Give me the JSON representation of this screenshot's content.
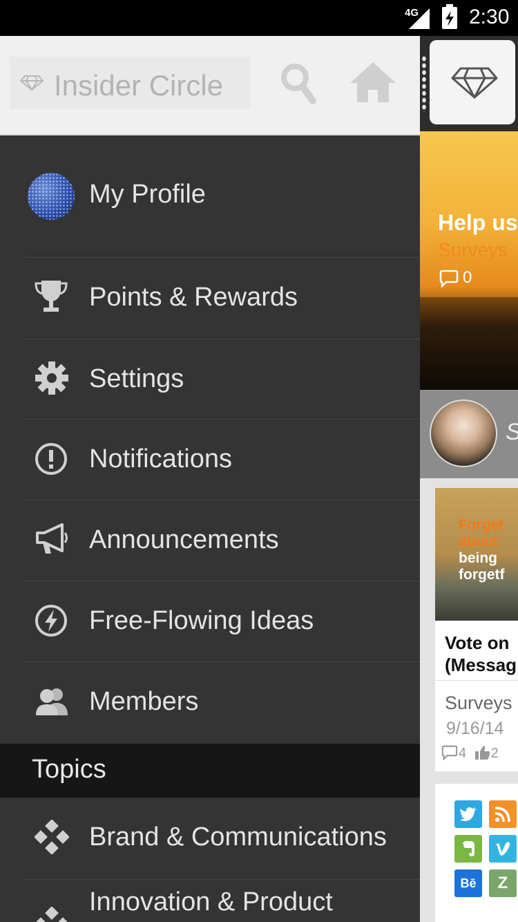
{
  "status_bar": {
    "network": "4G",
    "time": "2:30"
  },
  "drawer": {
    "search_placeholder": "Insider Circle",
    "items": [
      {
        "label": "My Profile",
        "icon": "avatar"
      },
      {
        "label": "Points & Rewards",
        "icon": "trophy-icon"
      },
      {
        "label": "Settings",
        "icon": "gear-icon"
      },
      {
        "label": "Notifications",
        "icon": "alert-icon"
      },
      {
        "label": "Announcements",
        "icon": "megaphone-icon"
      },
      {
        "label": "Free-Flowing Ideas",
        "icon": "bolt-icon"
      },
      {
        "label": "Members",
        "icon": "members-icon"
      }
    ],
    "topics_header": "Topics",
    "topics": [
      {
        "label": "Brand & Communications",
        "icon": "topic-diamond-icon"
      },
      {
        "label": "Innovation & Product",
        "icon": "topic-diamond-icon"
      }
    ]
  },
  "feed": {
    "hero": {
      "title": "Help us",
      "category": "Surveys",
      "comments": "0"
    },
    "user_initial": "S",
    "card1": {
      "image_text_orange": "Forget\nabout",
      "image_text_white": "being\nforgetf",
      "title": "Vote on\n(Messag",
      "category": "Surveys",
      "date": "9/16/14",
      "comments": "4",
      "likes": "2"
    },
    "social_icons": [
      "twitter-icon",
      "rss-icon",
      "evernote-icon",
      "vimeo-icon",
      "behance-icon",
      "zerply-icon"
    ]
  },
  "colors": {
    "drawer_bg": "#343434",
    "topics_bg": "#161616",
    "accent_orange": "#f08a1c"
  }
}
